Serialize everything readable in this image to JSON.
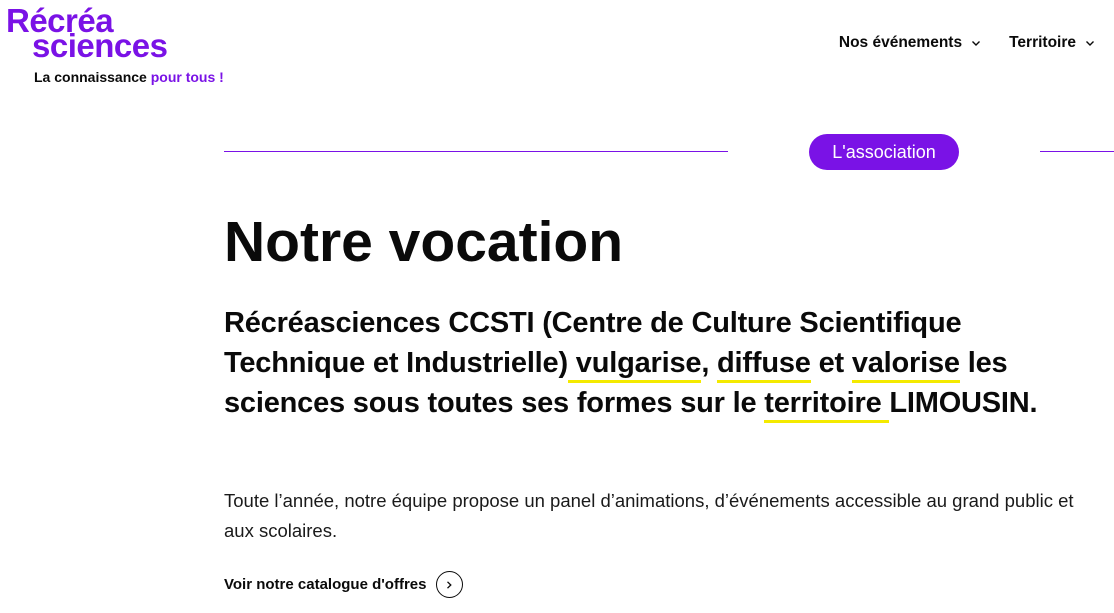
{
  "logo": {
    "line1": "Récréa",
    "line2": "sciences",
    "tagline_prefix": "La connaissance ",
    "tagline_accent": "pour tous !"
  },
  "nav": [
    {
      "label": "Nos événements",
      "icon": "chevron-down-icon"
    },
    {
      "label": "Territoire",
      "icon": "chevron-down-icon"
    }
  ],
  "section_badge": "L'association",
  "title": "Notre vocation",
  "lead": {
    "p1": "Récréasciences CCSTI (Centre de Culture Scientifique Technique et Industrielle)",
    "h1": " vulgarise",
    "p2": ", ",
    "h2": "diffuse",
    "p3": " et ",
    "h3": "valorise",
    "p4": " les sciences sous toutes ses formes sur le ",
    "h4": "territoire ",
    "p5": "LIMOUSIN."
  },
  "body": "Toute l’année, notre équipe propose un panel d’animations, d’événements accessible au grand public et aux scolaires.",
  "cta": {
    "label": "Voir notre catalogue d'offres",
    "icon": "chevron-right-icon"
  },
  "colors": {
    "brand": "#7a12e6",
    "highlight": "#f4ea00",
    "text": "#0a0a0a"
  }
}
